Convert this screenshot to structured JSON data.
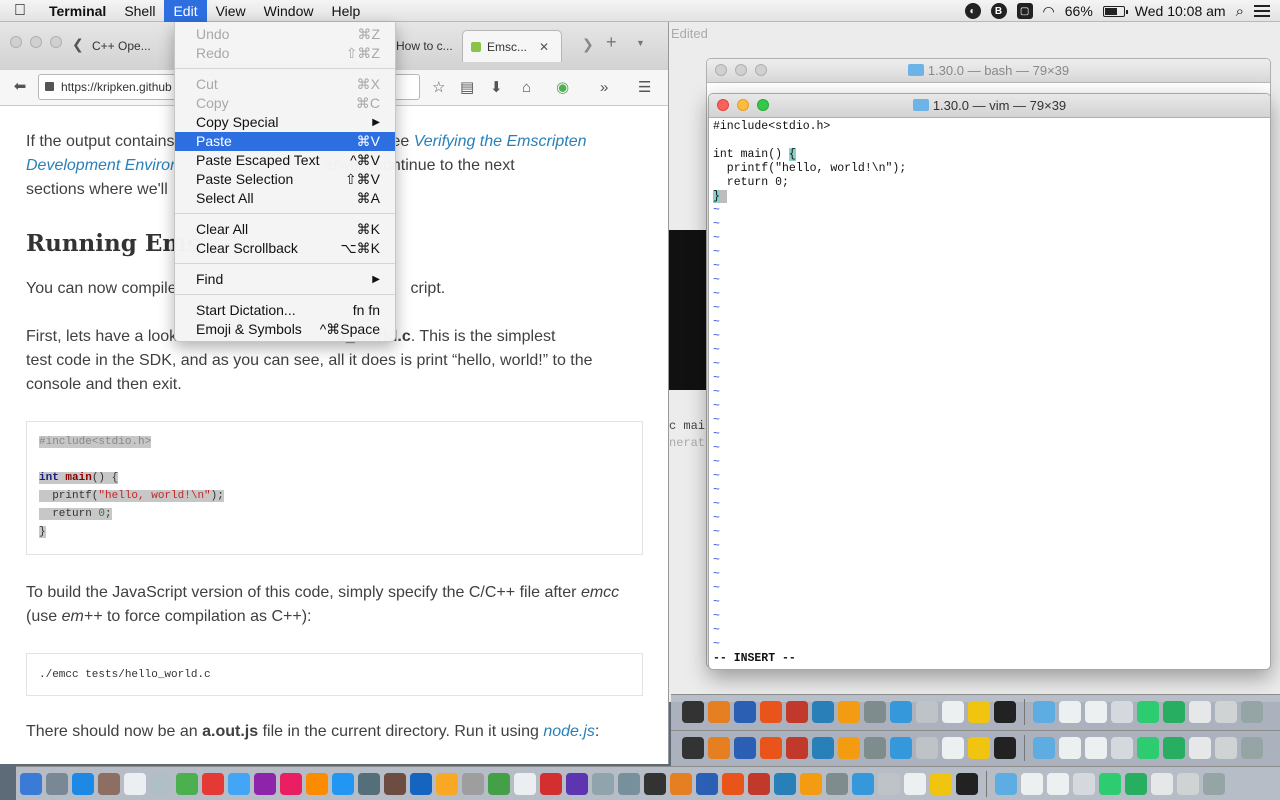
{
  "menubar": {
    "apple": "",
    "items": [
      "Terminal",
      "Shell",
      "Edit",
      "View",
      "Window",
      "Help"
    ],
    "active_index": 2,
    "status": {
      "battery": "66%",
      "clock": "Wed 10:08 am",
      "b_icon": "B"
    }
  },
  "edit_menu": {
    "items": [
      {
        "label": "Undo",
        "shortcut": "⌘Z",
        "disabled": true
      },
      {
        "label": "Redo",
        "shortcut": "⇧⌘Z",
        "disabled": true
      },
      {
        "sep": true
      },
      {
        "label": "Cut",
        "shortcut": "⌘X",
        "disabled": true
      },
      {
        "label": "Copy",
        "shortcut": "⌘C",
        "disabled": true
      },
      {
        "label": "Copy Special",
        "submenu": true
      },
      {
        "label": "Paste",
        "shortcut": "⌘V",
        "highlight": true
      },
      {
        "label": "Paste Escaped Text",
        "shortcut": "^⌘V"
      },
      {
        "label": "Paste Selection",
        "shortcut": "⇧⌘V"
      },
      {
        "label": "Select All",
        "shortcut": "⌘A"
      },
      {
        "sep": true
      },
      {
        "label": "Clear All",
        "shortcut": "⌘K"
      },
      {
        "label": "Clear Scrollback",
        "shortcut": "⌥⌘K"
      },
      {
        "sep": true
      },
      {
        "label": "Find",
        "submenu": true
      },
      {
        "sep": true
      },
      {
        "label": "Start Dictation...",
        "shortcut": "fn fn"
      },
      {
        "label": "Emoji & Symbols",
        "shortcut": "^⌘Space"
      }
    ]
  },
  "browser": {
    "tabs": [
      {
        "label": "C++ Ope...",
        "active": false
      },
      {
        "label": "How to c...",
        "active": false
      },
      {
        "label": "Emsc...",
        "active": true
      }
    ],
    "url": "https://kripken.github",
    "page": {
      "p1_a": "If the output contains",
      "p1_b": "see",
      "p1_link": "Verifying the Emscripten",
      "p1_c_link": "Development Enviror",
      "p1_d": "erwise continue to the next",
      "p1_e": "sections where we'll",
      "h2": "Running Ems",
      "p2_a": "You can now compile",
      "p2_b": "cript.",
      "p3_a": "First, lets have a look",
      "p3_b": "o_world.c",
      "p3_c": ". This is the simplest",
      "p3_d": "test code in the SDK, and as you can see, all it does is print “hello, world!” to the",
      "p3_e": "console and then exit.",
      "code1": {
        "l1": "#include<stdio.h>",
        "l3_kw": "int",
        "l3_fn": "main",
        "l3_rest": "() {",
        "l4_a": "  printf(",
        "l4_str": "\"hello, world!\\n\"",
        "l4_b": ");",
        "l5_a": "  return ",
        "l5_num": "0",
        "l5_b": ";",
        "l6": "}"
      },
      "p4_a": "To build the JavaScript version of this code, simply specify the C/C++ file after",
      "p4_em": "emcc",
      "p4_b": "(use",
      "p4_em2": "em++",
      "p4_c": "to force compilation as C++):",
      "code2": "./emcc tests/hello_world.c",
      "p5_a": "There should now be an",
      "p5_b": "a.out.js",
      "p5_c": "file in the current directory. Run it using",
      "p5_link": "node.js",
      "p5_d": ":"
    }
  },
  "bash_window": {
    "title": "1.30.0 — bash — 79×39"
  },
  "background_window": {
    "edited": "Edited",
    "snippet_a": "c main",
    "snippet_b": "nerate"
  },
  "vim_window": {
    "title": "1.30.0 — vim — 79×39",
    "lines": [
      "#include<stdio.h>",
      "",
      "int main() {",
      "  printf(\"hello, world!\\n\");",
      "  return 0;",
      "}"
    ],
    "tilde_count": 32,
    "status": "-- INSERT --"
  },
  "dock": {
    "accent": "#2d6fe0"
  }
}
